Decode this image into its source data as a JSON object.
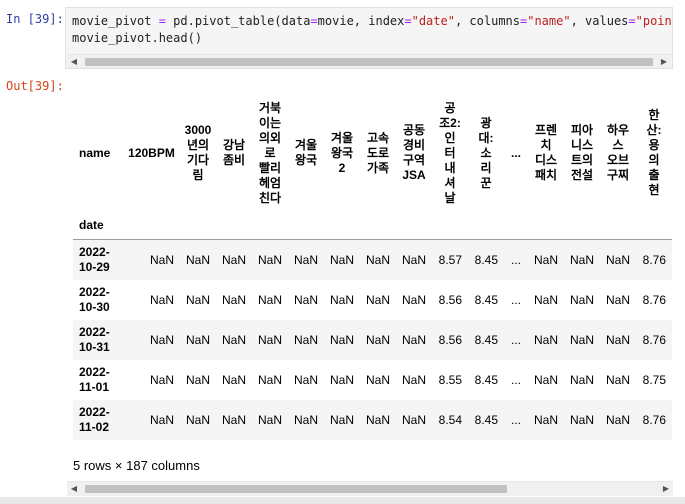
{
  "input_prompt": "In [39]:",
  "output_prompt": "Out[39]:",
  "code": {
    "line1": {
      "p1": "movie_pivot ",
      "op1": "=",
      "p2": " pd.pivot_table(data",
      "op2": "=",
      "p3": "movie, index",
      "op3": "=",
      "s1": "\"date\"",
      "p4": ", columns",
      "op4": "=",
      "s2": "\"name\"",
      "p5": ", values",
      "op5": "=",
      "s3": "\"point\""
    },
    "line2": "movie_pivot.head()"
  },
  "dataframe": {
    "index_name": "date",
    "columns_name": "name",
    "columns": [
      {
        "label": "120BPM",
        "lines": [
          "120BPM"
        ]
      },
      {
        "label": "3000년의 기다림",
        "lines": [
          "3000",
          "년의",
          "기다",
          "림"
        ]
      },
      {
        "label": "강남좀비",
        "lines": [
          "강남",
          "좀비"
        ]
      },
      {
        "label": "거북이는 의외로 빨리 헤엄친다",
        "lines": [
          "거북",
          "이는",
          "의외",
          "로",
          "빨리",
          "헤엄",
          "친다"
        ]
      },
      {
        "label": "겨울왕국",
        "lines": [
          "겨울",
          "왕국"
        ]
      },
      {
        "label": "겨울왕국 2",
        "lines": [
          "겨울",
          "왕국",
          "2"
        ]
      },
      {
        "label": "고속도로 가족",
        "lines": [
          "고속",
          "도로",
          "가족"
        ]
      },
      {
        "label": "공동경비구역 JSA",
        "lines": [
          "공동",
          "경비",
          "구역",
          "JSA"
        ]
      },
      {
        "label": "공조2: 인터내셔날",
        "lines": [
          "공",
          "조2:",
          "인",
          "터",
          "내",
          "셔",
          "날"
        ]
      },
      {
        "label": "광대: 소리꾼",
        "lines": [
          "광",
          "대:",
          "소",
          "리",
          "꾼"
        ]
      },
      {
        "label": "...",
        "lines": [
          "..."
        ]
      },
      {
        "label": "프렌치 디스패치",
        "lines": [
          "프렌",
          "치",
          "디스",
          "패치"
        ]
      },
      {
        "label": "피아니스트의 전설",
        "lines": [
          "피아",
          "니스",
          "트의",
          "전설"
        ]
      },
      {
        "label": "하우스 오브 구찌",
        "lines": [
          "하우",
          "스",
          "오브",
          "구찌"
        ]
      },
      {
        "label": "한산: 용의 출현",
        "lines": [
          "한",
          "산:",
          "용",
          "의",
          "출",
          "현"
        ]
      }
    ],
    "rows": [
      {
        "date_lines": [
          "2022-",
          "10-29"
        ],
        "values": [
          "NaN",
          "NaN",
          "NaN",
          "NaN",
          "NaN",
          "NaN",
          "NaN",
          "NaN",
          "8.57",
          "8.45",
          "...",
          "NaN",
          "NaN",
          "NaN",
          "8.76"
        ]
      },
      {
        "date_lines": [
          "2022-",
          "10-30"
        ],
        "values": [
          "NaN",
          "NaN",
          "NaN",
          "NaN",
          "NaN",
          "NaN",
          "NaN",
          "NaN",
          "8.56",
          "8.45",
          "...",
          "NaN",
          "NaN",
          "NaN",
          "8.76"
        ]
      },
      {
        "date_lines": [
          "2022-",
          "10-31"
        ],
        "values": [
          "NaN",
          "NaN",
          "NaN",
          "NaN",
          "NaN",
          "NaN",
          "NaN",
          "NaN",
          "8.56",
          "8.45",
          "...",
          "NaN",
          "NaN",
          "NaN",
          "8.76"
        ]
      },
      {
        "date_lines": [
          "2022-",
          "11-01"
        ],
        "values": [
          "NaN",
          "NaN",
          "NaN",
          "NaN",
          "NaN",
          "NaN",
          "NaN",
          "NaN",
          "8.55",
          "8.45",
          "...",
          "NaN",
          "NaN",
          "NaN",
          "8.75"
        ]
      },
      {
        "date_lines": [
          "2022-",
          "11-02"
        ],
        "values": [
          "NaN",
          "NaN",
          "NaN",
          "NaN",
          "NaN",
          "NaN",
          "NaN",
          "NaN",
          "8.54",
          "8.45",
          "...",
          "NaN",
          "NaN",
          "NaN",
          "8.76"
        ]
      }
    ],
    "shape_text": "5 rows × 187 columns"
  },
  "icons": {
    "scroll_left": "triangle-left-icon",
    "scroll_right": "triangle-right-icon"
  }
}
